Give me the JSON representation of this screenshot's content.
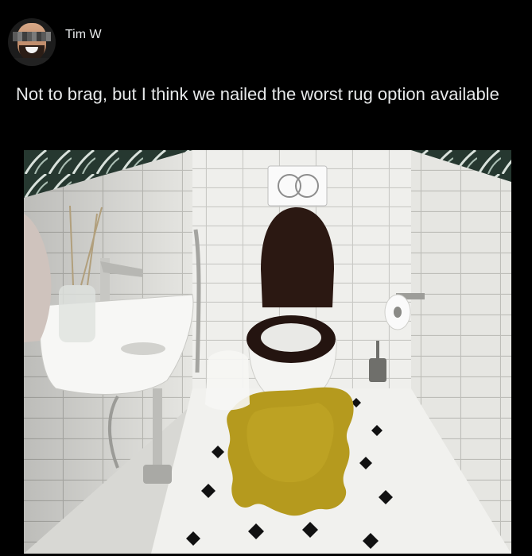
{
  "post": {
    "author": {
      "name": "Tim W",
      "avatar_icon": "person-avatar-icon"
    },
    "text": "Not to brag, but I think we nailed the worst rug option available"
  },
  "colors": {
    "background": "#000000",
    "text": "#e7e9ea",
    "rug": "#b59a1e",
    "tile": "#ececea",
    "seat": "#2a1a14"
  }
}
